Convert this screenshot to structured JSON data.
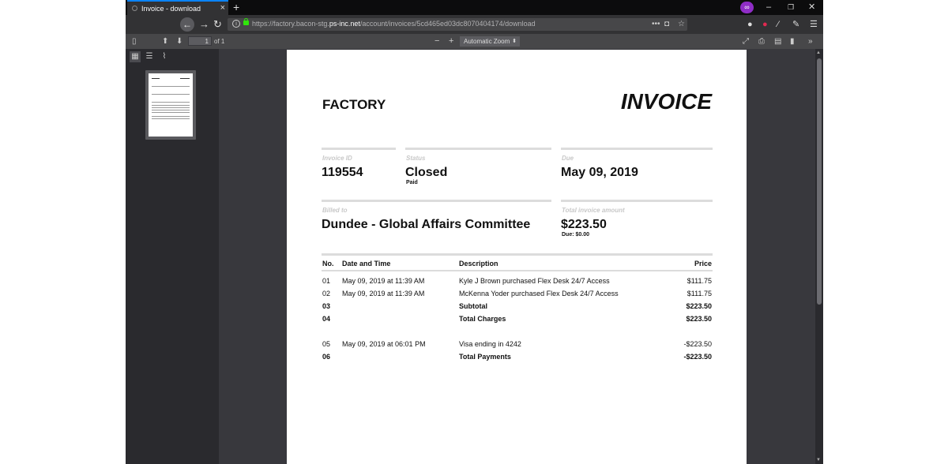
{
  "browser": {
    "tab_title": "Invoice - download",
    "tab_close": "×",
    "new_tab": "+",
    "url_domain_prefix": "https://factory.bacon-stg.",
    "url_domain": "ps-inc.net",
    "url_path": "/account/invoices/5cd465ed03dc8070404174/download",
    "window_controls": [
      "–",
      "❐",
      "✕"
    ]
  },
  "pdf_toolbar": {
    "page_number": "1",
    "page_count": "of 1",
    "zoom": "Automatic Zoom",
    "zoom_out": "−",
    "zoom_in": "+"
  },
  "invoice": {
    "company": "FACTORY",
    "title": "INVOICE",
    "invoice_id_label": "Invoice ID",
    "invoice_id": "119554",
    "status_label": "Status",
    "status": "Closed",
    "status_sub": "Paid",
    "due_label": "Due",
    "due": "May 09, 2019",
    "billed_label": "Billed to",
    "billed_to": "Dundee - Global Affairs Committee",
    "total_label": "Total invoice amount",
    "total": "$223.50",
    "total_due": "Due: $0.00",
    "columns": {
      "no": "No.",
      "date": "Date and Time",
      "desc": "Description",
      "price": "Price"
    },
    "rows": [
      {
        "no": "01",
        "date": "May 09, 2019 at 11:39 AM",
        "desc": "Kyle J Brown purchased Flex Desk 24/7 Access",
        "price": "$111.75"
      },
      {
        "no": "02",
        "date": "May 09, 2019 at 11:39 AM",
        "desc": "McKenna Yoder purchased Flex Desk 24/7 Access",
        "price": "$111.75"
      },
      {
        "no": "03",
        "date": "",
        "desc": "Subtotal",
        "price": "$223.50"
      },
      {
        "no": "04",
        "date": "",
        "desc": "Total Charges",
        "price": "$223.50"
      },
      {
        "no": "05",
        "date": "May 09, 2019 at 06:01 PM",
        "desc": "Visa ending in 4242",
        "price": "-$223.50"
      },
      {
        "no": "06",
        "date": "",
        "desc": "Total Payments",
        "price": "-$223.50"
      }
    ]
  }
}
